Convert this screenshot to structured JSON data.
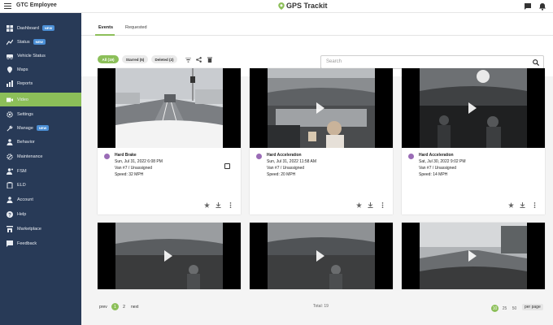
{
  "header": {
    "org_name": "GTC Employee",
    "logo_text": "GPS Trackit"
  },
  "sidebar": {
    "items": [
      {
        "label": "Dashboard",
        "badge": "NEW",
        "icon": "dashboard-icon"
      },
      {
        "label": "Status",
        "badge": "NEW",
        "icon": "trend-icon"
      },
      {
        "label": "Vehicle Status",
        "badge": "",
        "icon": "vehicle-icon"
      },
      {
        "label": "Maps",
        "badge": "",
        "icon": "map-pin-icon"
      },
      {
        "label": "Reports",
        "badge": "",
        "icon": "report-icon"
      },
      {
        "label": "Video",
        "badge": "",
        "icon": "video-icon",
        "active": true
      },
      {
        "label": "Settings",
        "badge": "",
        "icon": "gear-icon"
      },
      {
        "label": "Manage",
        "badge": "NEW",
        "icon": "wrench-icon"
      },
      {
        "label": "Behavior",
        "badge": "",
        "icon": "person-icon"
      },
      {
        "label": "Maintenance",
        "badge": "",
        "icon": "gear-wrench-icon"
      },
      {
        "label": "FSM",
        "badge": "",
        "icon": "person-badge-icon"
      },
      {
        "label": "ELD",
        "badge": "",
        "icon": "clipboard-icon"
      },
      {
        "label": "Account",
        "badge": "",
        "icon": "account-icon"
      },
      {
        "label": "Help",
        "badge": "",
        "icon": "help-icon"
      },
      {
        "label": "Marketplace",
        "badge": "",
        "icon": "store-icon"
      },
      {
        "label": "Feedback",
        "badge": "",
        "icon": "feedback-icon"
      }
    ]
  },
  "tabs": [
    {
      "label": "Events"
    },
    {
      "label": "Requested"
    }
  ],
  "filters": [
    {
      "label": "All (19)"
    },
    {
      "label": "Starred (5)"
    },
    {
      "label": "Deleted (2)"
    }
  ],
  "search": {
    "placeholder": "Search"
  },
  "events": [
    {
      "title": "Hard Brake",
      "date": "Sun, Jul 31, 2022 6:08 PM",
      "vehicle": "Van #7 / Unassigned",
      "speed": "Speed: 32 MPH"
    },
    {
      "title": "Hard Acceleration",
      "date": "Sun, Jul 31, 2022 11:58 AM",
      "vehicle": "Van #7 / Unassigned",
      "speed": "Speed: 20 MPH"
    },
    {
      "title": "Hard Acceleration",
      "date": "Sat, Jul 30, 2022 9:02 PM",
      "vehicle": "Van #7 / Unassigned",
      "speed": "Speed: 14 MPH"
    }
  ],
  "pagination": {
    "prev": "prev",
    "pages": [
      "1",
      "2"
    ],
    "next": "next",
    "total": "Total: 19",
    "sizes": [
      "10",
      "25",
      "50"
    ],
    "per_page": "per page"
  },
  "colors": {
    "sidebar": "#283a57",
    "accent": "#8cbf59",
    "event_icon": "#9a6cb6",
    "badge": "#4b8fd6"
  }
}
